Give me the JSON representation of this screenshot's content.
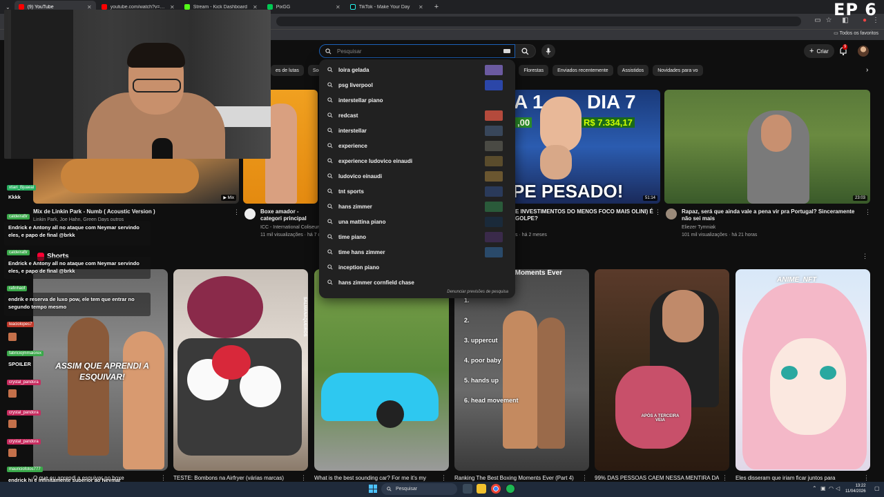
{
  "overlay_label": "EP 6",
  "browser": {
    "tabs": [
      {
        "label": "(9) YouTube",
        "color": "#ff0000",
        "active": true
      },
      {
        "label": "youtube.com/watch?v=CV4h2r",
        "color": "#ff0000",
        "active": false
      },
      {
        "label": "Stream - Kick Dashboard",
        "color": "#53fc18",
        "active": false
      },
      {
        "label": "PixGG",
        "color": "#00c853",
        "active": false
      },
      {
        "label": "TikTok - Make Your Day",
        "color": "#111111",
        "active": false
      }
    ],
    "new_tab": "+",
    "bookmarks_all": "Todos os favoritos"
  },
  "youtube": {
    "search_placeholder": "Pesquisar",
    "create_label": "Criar",
    "notif_count": "9",
    "chips": [
      "es de lutas",
      "Socos",
      "Funk carioca",
      "Metal alternativo",
      "Milionários",
      "Empreendedorismo",
      "Florestas",
      "Enviados recentemente",
      "Assistidos",
      "Novidades para vo"
    ],
    "suggestions": [
      {
        "text": "loira gelada",
        "thumb": "#6b5aa0"
      },
      {
        "text": "psg liverpool",
        "thumb": "#2b46a8"
      },
      {
        "text": "interstellar piano",
        "thumb": ""
      },
      {
        "text": "redcast",
        "thumb": "#b44a3c"
      },
      {
        "text": "interstellar",
        "thumb": "#38465a"
      },
      {
        "text": "experience",
        "thumb": "#4a4a44"
      },
      {
        "text": "experience ludovico einaudi",
        "thumb": "#5a4c2c"
      },
      {
        "text": "ludovico einaudi",
        "thumb": "#6a5630"
      },
      {
        "text": "tnt sports",
        "thumb": "#2a3a5a"
      },
      {
        "text": "hans zimmer",
        "thumb": "#2a5a3a"
      },
      {
        "text": "una mattina piano",
        "thumb": "#1a2a3a"
      },
      {
        "text": "time piano",
        "thumb": "#3a2a4a"
      },
      {
        "text": "time hans zimmer",
        "thumb": "#2a4a6a"
      },
      {
        "text": "inception piano",
        "thumb": ""
      },
      {
        "text": "hans zimmer cornfield chase",
        "thumb": ""
      }
    ],
    "report_label": "Denunciar previsões de pesquisa",
    "videos": [
      {
        "title": "Mix de Linkin Park - Numb ( Acoustic Version )",
        "meta1": "Linkin Park, Joe Hahn, Green Days outros",
        "meta2": "",
        "badge": "Mix"
      },
      {
        "title": "Boxe amador - categori principal",
        "meta1": "ICC - International Coliseum",
        "meta2": "11 mil visualizações · há 7 d",
        "badge": ""
      },
      {
        "title": "E INVESTIMENTOS DO MENOS FOCO MAIS OLINI) É GOLPE?",
        "meta1": "s · há 2 meses",
        "meta2": "",
        "badge": "51:14"
      },
      {
        "title": "Rapaz, será que ainda vale a pena vir pra Portugal? Sinceramente não sei mais",
        "meta1": "Eliezer Tymniak",
        "meta2": "101 mil visualizações · há 21 horas",
        "badge": "23:03"
      }
    ],
    "thumb_text": {
      "dia": "DIA 7",
      "a1": "A 1",
      "money1": ",00",
      "money2": "R$ 7.334,17",
      "pesado": "PE PESADO!"
    },
    "shorts_title": "Shorts",
    "shorts": [
      {
        "title": "O que eu aprendi a esquivar no boxe",
        "overlay": "ASSIM QUE APRENDI A ESQUIVAR!"
      },
      {
        "title": "TESTE: Bombons na Airfryer (várias marcas)",
        "overlay": "SALMANAQUEIROS"
      },
      {
        "title": "What is the best sounding car? For me it's my",
        "overlay": ""
      },
      {
        "title": "Ranking The Best Boxing Moments Ever (Part 4)",
        "overlay": "The Best Boxing Moments Ever"
      },
      {
        "title": "99% DAS PESSOAS CAEM NESSA MENTIRA DA",
        "overlay": "APÓS A TERCEIRA VEIA"
      },
      {
        "title": "Eles disseram que iriam ficar juntos para",
        "overlay": "ANIME_NFT"
      }
    ],
    "ranking": [
      "1.",
      "2.",
      "3. uppercut",
      "4. poor baby",
      "5. hands up",
      "6. head movement"
    ]
  },
  "chat": [
    {
      "user": "xtiari_Bjuaeal",
      "msg": "Kkkk",
      "style": "green2"
    },
    {
      "user": "caldeiraBr",
      "msg": "Endrick e Antony all no ataque com Neymar servindo eles, e papo de final @brkk",
      "style": ""
    },
    {
      "user": "caldeiraBr",
      "msg": "Endrick e Antony all no ataque com Neymar servindo eles, e papo de final @brkk",
      "style": ""
    },
    {
      "user": "rafinhaof",
      "msg": "endrik e reserva de luxo pow, ele tem que entrar no segundo tempo mesmo",
      "style": ""
    },
    {
      "user": "leaciolopes7",
      "msg": "",
      "style": "red"
    },
    {
      "user": "fabriciojmmaiorex",
      "msg": "SPOILER",
      "style": ""
    },
    {
      "user": "crystal_pandora",
      "msg": "",
      "style": "pink"
    },
    {
      "user": "crystal_pandora",
      "msg": "",
      "style": "pink"
    },
    {
      "user": "crystal_pandora",
      "msg": "",
      "style": "pink"
    },
    {
      "user": "mauriciofotos777",
      "msg": "endrick hj é infinitamente superior ao Neymar",
      "style": ""
    }
  ],
  "taskbar": {
    "search_label": "Pesquisar",
    "time": "13:22",
    "date": "11/04/2026"
  }
}
